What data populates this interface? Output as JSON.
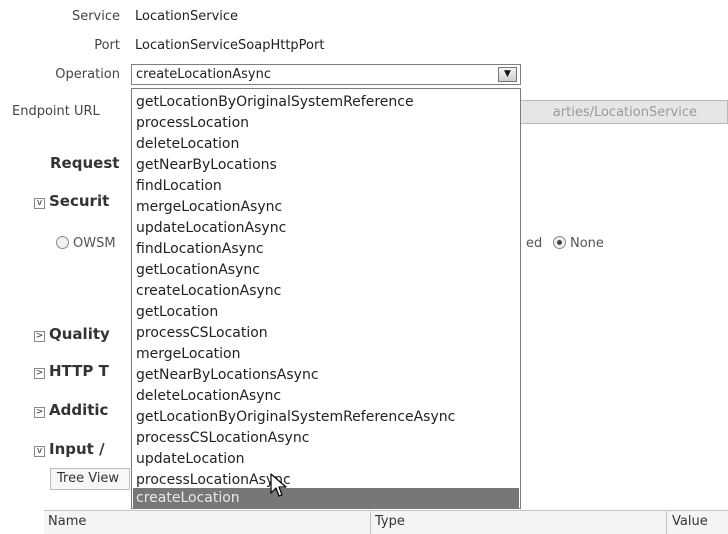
{
  "service": {
    "label": "Service",
    "value": "LocationService"
  },
  "port": {
    "label": "Port",
    "value": "LocationServiceSoapHttpPort"
  },
  "operation": {
    "label": "Operation",
    "selected": "createLocationAsync",
    "options": [
      "getLocationByOriginalSystemReference",
      "processLocation",
      "deleteLocation",
      "getNearByLocations",
      "findLocation",
      "mergeLocationAsync",
      "updateLocationAsync",
      "findLocationAsync",
      "getLocationAsync",
      "createLocationAsync",
      "getLocation",
      "processCSLocation",
      "mergeLocation",
      "getNearByLocationsAsync",
      "deleteLocationAsync",
      "getLocationByOriginalSystemReferenceAsync",
      "processCSLocationAsync",
      "updateLocation",
      "processLocationAsync",
      "createLocation"
    ],
    "highlighted": "createLocation"
  },
  "endpoint": {
    "label": "Endpoint URL",
    "value_visible": "arties/LocationService"
  },
  "request": {
    "label": "Request"
  },
  "sections": {
    "security": "Securit",
    "quality": "Quality",
    "http": "HTTP T",
    "additional": "Additic",
    "input": "Input /"
  },
  "security": {
    "owsm_label": "OWSM",
    "ed_label": "ed",
    "none_label": "None",
    "selected": "None"
  },
  "tree_view": {
    "label": "Tree View"
  },
  "table": {
    "columns": [
      "Name",
      "Type",
      "Value"
    ]
  },
  "icons": {
    "dropdown_arrow": "chevron-down-icon",
    "expanded": "triangle-down-icon",
    "collapsed": "triangle-right-icon",
    "cursor": "mouse-pointer-icon"
  }
}
